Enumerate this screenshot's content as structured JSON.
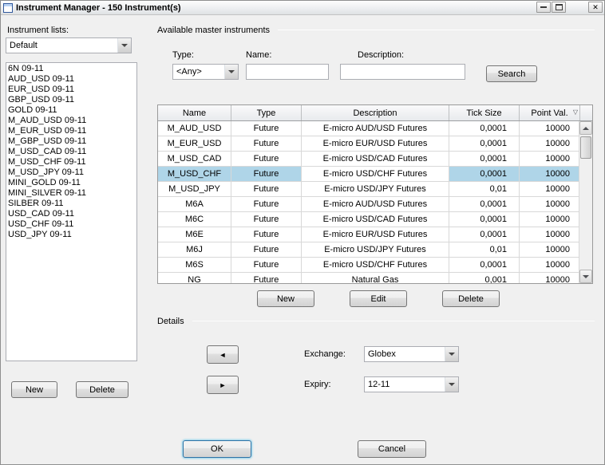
{
  "window": {
    "title": "Instrument Manager - 150 Instrument(s)"
  },
  "icons": {
    "close_glyph": "✕",
    "left_arrow": "◄",
    "right_arrow": "►",
    "sort_glyph": "▽"
  },
  "left_panel": {
    "label": "Instrument lists:",
    "list_value": "Default",
    "instruments": [
      "6N 09-11",
      "AUD_USD 09-11",
      "EUR_USD 09-11",
      "GBP_USD 09-11",
      "GOLD 09-11",
      "M_AUD_USD 09-11",
      "M_EUR_USD 09-11",
      "M_GBP_USD 09-11",
      "M_USD_CAD 09-11",
      "M_USD_CHF 09-11",
      "M_USD_JPY 09-11",
      "MINI_GOLD 09-11",
      "MINI_SILVER 09-11",
      "SILBER 09-11",
      "USD_CAD 09-11",
      "USD_CHF 09-11",
      "USD_JPY 09-11"
    ],
    "new_label": "New",
    "delete_label": "Delete"
  },
  "right_panel": {
    "group_label": "Available master instruments",
    "filters": {
      "type_label": "Type:",
      "type_value": "<Any>",
      "name_label": "Name:",
      "name_value": "",
      "description_label": "Description:",
      "description_value": "",
      "search_label": "Search"
    },
    "table": {
      "columns": [
        "Name",
        "Type",
        "Description",
        "Tick Size",
        "Point Val."
      ],
      "selected_row_index": 3,
      "rows": [
        [
          "M_AUD_USD",
          "Future",
          "E-micro AUD/USD Futures",
          "0,0001",
          "10000"
        ],
        [
          "M_EUR_USD",
          "Future",
          "E-micro EUR/USD Futures",
          "0,0001",
          "10000"
        ],
        [
          "M_USD_CAD",
          "Future",
          "E-micro USD/CAD Futures",
          "0,0001",
          "10000"
        ],
        [
          "M_USD_CHF",
          "Future",
          "E-micro USD/CHF Futures",
          "0,0001",
          "10000"
        ],
        [
          "M_USD_JPY",
          "Future",
          "E-micro USD/JPY Futures",
          "0,01",
          "10000"
        ],
        [
          "M6A",
          "Future",
          "E-micro AUD/USD Futures",
          "0,0001",
          "10000"
        ],
        [
          "M6C",
          "Future",
          "E-micro USD/CAD Futures",
          "0,0001",
          "10000"
        ],
        [
          "M6E",
          "Future",
          "E-micro EUR/USD Futures",
          "0,0001",
          "10000"
        ],
        [
          "M6J",
          "Future",
          "E-micro USD/JPY Futures",
          "0,01",
          "10000"
        ],
        [
          "M6S",
          "Future",
          "E-micro USD/CHF Futures",
          "0,0001",
          "10000"
        ],
        [
          "NG",
          "Future",
          "Natural Gas",
          "0,001",
          "10000"
        ]
      ]
    },
    "buttons": {
      "new_label": "New",
      "edit_label": "Edit",
      "delete_label": "Delete"
    },
    "details": {
      "label": "Details",
      "exchange_label": "Exchange:",
      "exchange_value": "Globex",
      "expiry_label": "Expiry:",
      "expiry_value": "12-11"
    }
  },
  "footer": {
    "ok_label": "OK",
    "cancel_label": "Cancel"
  }
}
